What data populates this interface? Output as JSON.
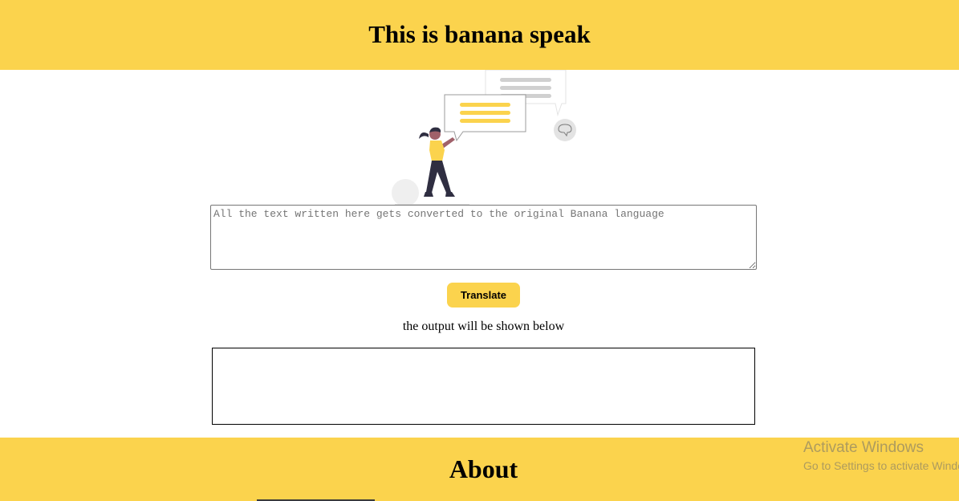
{
  "header": {
    "title": "This is banana speak"
  },
  "input": {
    "placeholder": "All the text written here gets converted to the original Banana language",
    "value": ""
  },
  "translate_button": {
    "label": "Translate"
  },
  "output": {
    "caption": "the output will be shown below",
    "text": ""
  },
  "footer": {
    "title": "About"
  },
  "watermark": {
    "title": "Activate Windows",
    "subtitle": "Go to Settings to activate Windows."
  },
  "colors": {
    "accent": "#fbd34d",
    "figure_shirt": "#fbd34d",
    "figure_pants": "#2f2e41"
  },
  "illustration": {
    "name": "person-with-chat-bubbles-illustration"
  }
}
